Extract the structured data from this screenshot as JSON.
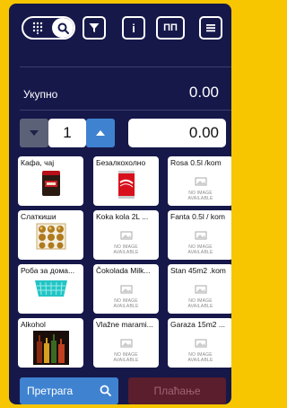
{
  "toolbar": {
    "filter_icon": "filter-icon",
    "info_label": "i",
    "pp_label": "ПП",
    "menu_icon": "hamburger-icon"
  },
  "summary": {
    "total_label": "Укупно",
    "total_value": "0.00"
  },
  "quantity": {
    "value": "1",
    "amount": "0.00"
  },
  "products": [
    {
      "label": "Кафа, чај",
      "image": "coffee"
    },
    {
      "label": "Безалкохолно",
      "image": "cola"
    },
    {
      "label": "Rosa 0.5l /kom",
      "image": "none"
    },
    {
      "label": "Слаткиши",
      "image": "chocolates"
    },
    {
      "label": "Koka kola 2L ...",
      "image": "none"
    },
    {
      "label": "Fanta 0.5l / kom",
      "image": "none"
    },
    {
      "label": "Роба за дома...",
      "image": "basket"
    },
    {
      "label": "Čokolada Milk...",
      "image": "none"
    },
    {
      "label": "Stan 45m2 .kom",
      "image": "none"
    },
    {
      "label": "Alkohol",
      "image": "bottles"
    },
    {
      "label": "Vlažne marami...",
      "image": "none"
    },
    {
      "label": "Garaza 15m2 ...",
      "image": "none"
    }
  ],
  "no_image_text": [
    "NO IMAGE",
    "AVAILABLE"
  ],
  "footer": {
    "search_label": "Претрага",
    "pay_label": "Плаћање"
  },
  "colors": {
    "background": "#f7c600",
    "panel": "#16184a",
    "accent": "#3f83d0",
    "pay_disabled": "#5a1e2d"
  }
}
